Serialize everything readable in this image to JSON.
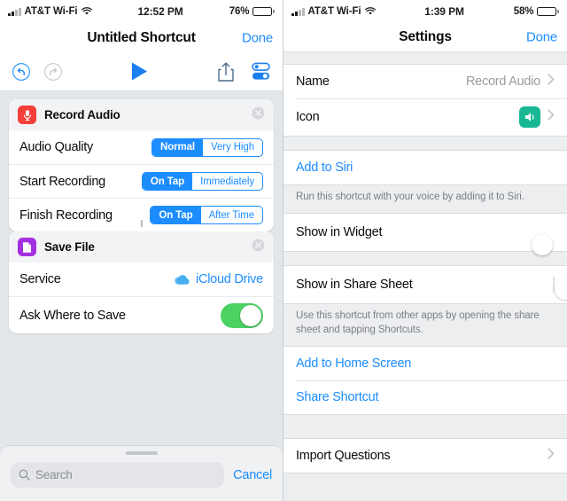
{
  "left": {
    "status": {
      "carrier": "AT&T Wi-Fi",
      "time": "12:52 PM",
      "battery": "76%"
    },
    "nav": {
      "title": "Untitled Shortcut",
      "done": "Done"
    },
    "toolbar": {
      "undo": "undo-icon",
      "redo": "redo-icon",
      "play": "play-icon",
      "share": "share-icon",
      "settings": "settings-toggles-icon"
    },
    "cards": [
      {
        "title": "Record Audio",
        "icon": "microphone-icon",
        "icon_color": "#f43f3a",
        "rows": [
          {
            "label": "Audio Quality",
            "type": "segmented",
            "options": [
              "Normal",
              "Very High"
            ],
            "selected": 0
          },
          {
            "label": "Start Recording",
            "type": "segmented",
            "options": [
              "On Tap",
              "Immediately"
            ],
            "selected": 0
          },
          {
            "label": "Finish Recording",
            "type": "segmented",
            "options": [
              "On Tap",
              "After Time"
            ],
            "selected": 0
          }
        ]
      },
      {
        "title": "Save File",
        "icon": "document-icon",
        "icon_color": "#a42fe0",
        "rows": [
          {
            "label": "Service",
            "type": "value",
            "value": "iCloud Drive",
            "value_icon": "icloud-icon"
          },
          {
            "label": "Ask Where to Save",
            "type": "switch",
            "on": true
          }
        ]
      }
    ],
    "sheet": {
      "search_placeholder": "Search",
      "search_value": "",
      "cancel": "Cancel"
    }
  },
  "right": {
    "status": {
      "carrier": "AT&T Wi-Fi",
      "time": "1:39 PM",
      "battery": "58%"
    },
    "nav": {
      "title": "Settings",
      "done": "Done"
    },
    "rows": {
      "name_label": "Name",
      "name_value": "Record Audio",
      "icon_label": "Icon",
      "icon_glyph": "speaker-icon",
      "icon_color": "#17b794",
      "add_to_siri": "Add to Siri",
      "siri_footnote": "Run this shortcut with your voice by adding it to Siri.",
      "show_in_widget": "Show in Widget",
      "show_in_widget_on": true,
      "show_in_share_sheet": "Show in Share Sheet",
      "show_in_share_sheet_on": false,
      "share_sheet_footnote": "Use this shortcut from other apps by opening the share sheet and tapping Shortcuts.",
      "add_to_home_screen": "Add to Home Screen",
      "share_shortcut": "Share Shortcut",
      "import_questions": "Import Questions"
    }
  },
  "colors": {
    "accent": "#1c8dff",
    "green": "#4cd262",
    "red": "#f43f3a",
    "purple": "#a42fe0",
    "teal": "#17b794"
  }
}
